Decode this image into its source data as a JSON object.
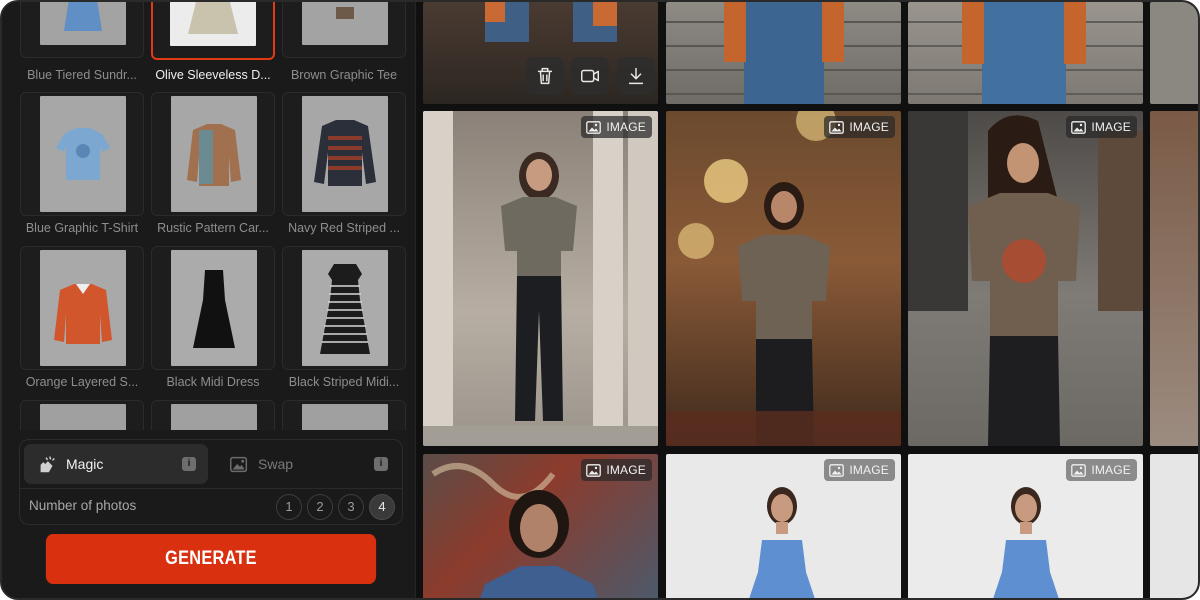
{
  "products": [
    {
      "label": "Blue Tiered Sundr...",
      "selected": false
    },
    {
      "label": "Olive Sleeveless D...",
      "selected": true
    },
    {
      "label": "Brown Graphic Tee",
      "selected": false
    },
    {
      "label": "Blue Graphic T-Shirt",
      "selected": false
    },
    {
      "label": "Rustic Pattern Car...",
      "selected": false
    },
    {
      "label": "Navy Red Striped ...",
      "selected": false
    },
    {
      "label": "Orange Layered S...",
      "selected": false
    },
    {
      "label": "Black Midi Dress",
      "selected": false
    },
    {
      "label": "Black Striped Midi...",
      "selected": false
    }
  ],
  "modes": {
    "magic": {
      "label": "Magic",
      "active": true
    },
    "swap": {
      "label": "Swap",
      "active": false
    },
    "info_glyph": "i"
  },
  "photos": {
    "label": "Number of photos",
    "options": [
      "1",
      "2",
      "3",
      "4"
    ],
    "selected": "4"
  },
  "generate_label": "GENERATE",
  "gallery": {
    "badge_label": "IMAGE",
    "actions": [
      "trash-icon",
      "video-icon",
      "download-icon"
    ]
  },
  "colors": {
    "accent": "#d9300f",
    "panel": "#1a1a1a",
    "background": "#111111"
  }
}
